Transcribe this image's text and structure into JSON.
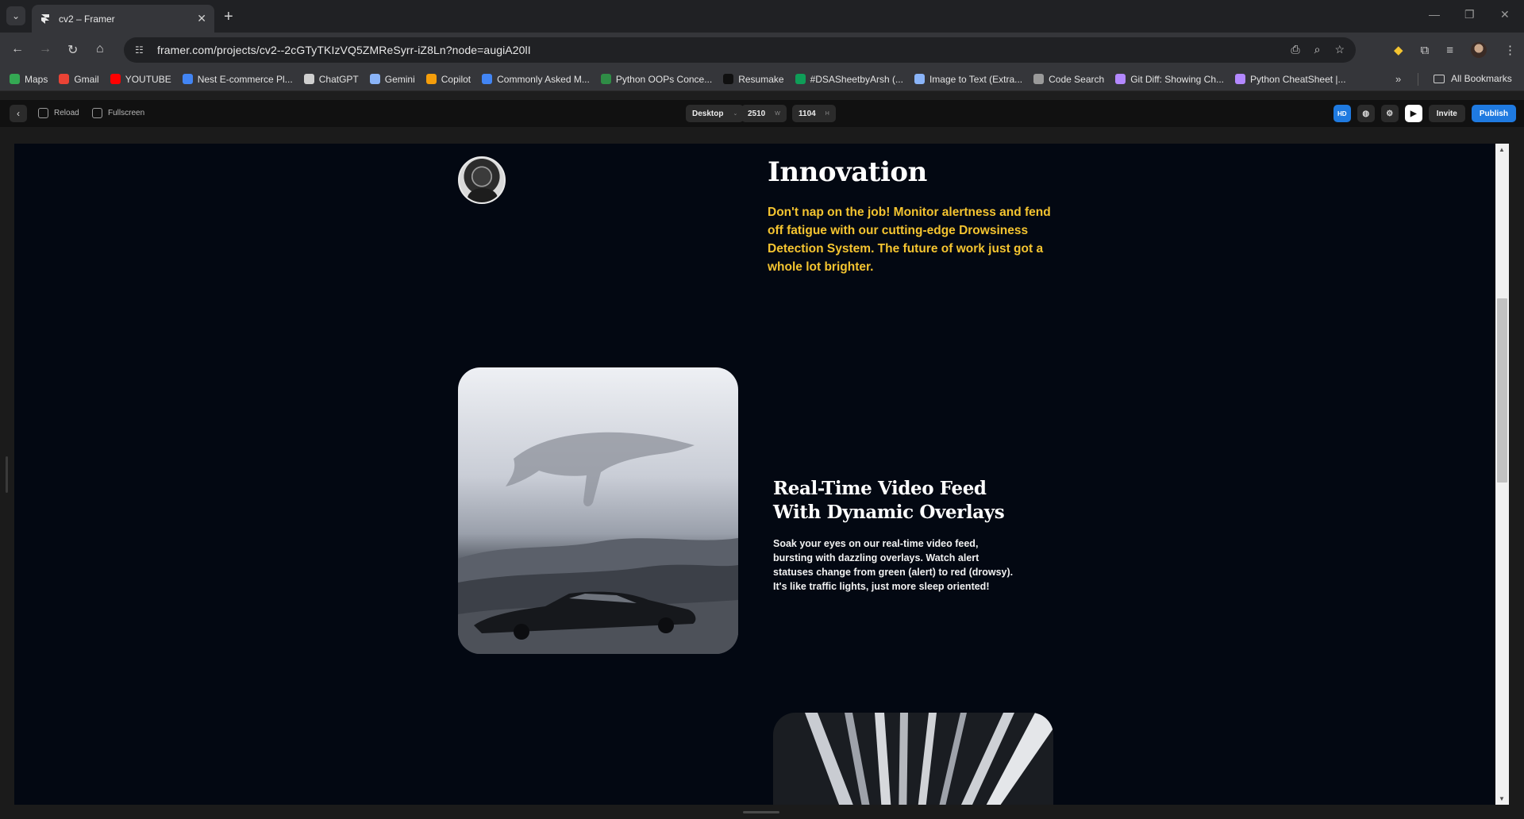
{
  "browser": {
    "tab_title": "cv2 – Framer",
    "url": "framer.com/projects/cv2--2cGTyTKIzVQ5ZMReSyrr-iZ8Ln?node=augiA20lI",
    "bookmarks": [
      {
        "label": "Maps",
        "color": "#34a853"
      },
      {
        "label": "Gmail",
        "color": "#ea4335"
      },
      {
        "label": "YOUTUBE",
        "color": "#ff0000"
      },
      {
        "label": "Nest E-commerce Pl...",
        "color": "#4285f4"
      },
      {
        "label": "ChatGPT",
        "color": "#cfcfcf"
      },
      {
        "label": "Gemini",
        "color": "#8ab4f8"
      },
      {
        "label": "Copilot",
        "color": "#f59e0b"
      },
      {
        "label": "Commonly Asked M...",
        "color": "#4285f4"
      },
      {
        "label": "Python OOPs Conce...",
        "color": "#2f8d46"
      },
      {
        "label": "Resumake",
        "color": "#101010"
      },
      {
        "label": "#DSASheetbyArsh (...",
        "color": "#0f9d58"
      },
      {
        "label": "Image to Text (Extra...",
        "color": "#8ab4f8"
      },
      {
        "label": "Code Search",
        "color": "#9a9a9a"
      },
      {
        "label": "Git Diff: Showing Ch...",
        "color": "#b388ff"
      },
      {
        "label": "Python CheatSheet |...",
        "color": "#b388ff"
      }
    ],
    "all_bookmarks": "All Bookmarks",
    "more": "»"
  },
  "framer": {
    "reload": "Reload",
    "fullscreen": "Fullscreen",
    "device": "Desktop",
    "width": "2510",
    "width_unit": "W",
    "height": "1104",
    "height_unit": "H",
    "hd": "HD",
    "invite": "Invite",
    "publish": "Publish"
  },
  "page": {
    "innovation_title": "Innovation",
    "innovation_text": "Don't nap on the job! Monitor alertness and fend off fatigue with our cutting-edge Drowsiness Detection System. The future of work just got a whole lot brighter.",
    "feed_title": "Real-Time Video Feed With Dynamic Overlays",
    "feed_text": "Soak your eyes on our real-time video feed, bursting with dazzling overlays. Watch alert statuses change from green (alert) to red (drowsy). It's like traffic lights, just more sleep oriented!"
  },
  "colors": {
    "page_bg": "#030812",
    "accent_yellow": "#f4c430",
    "publish_blue": "#1f7ae0"
  }
}
